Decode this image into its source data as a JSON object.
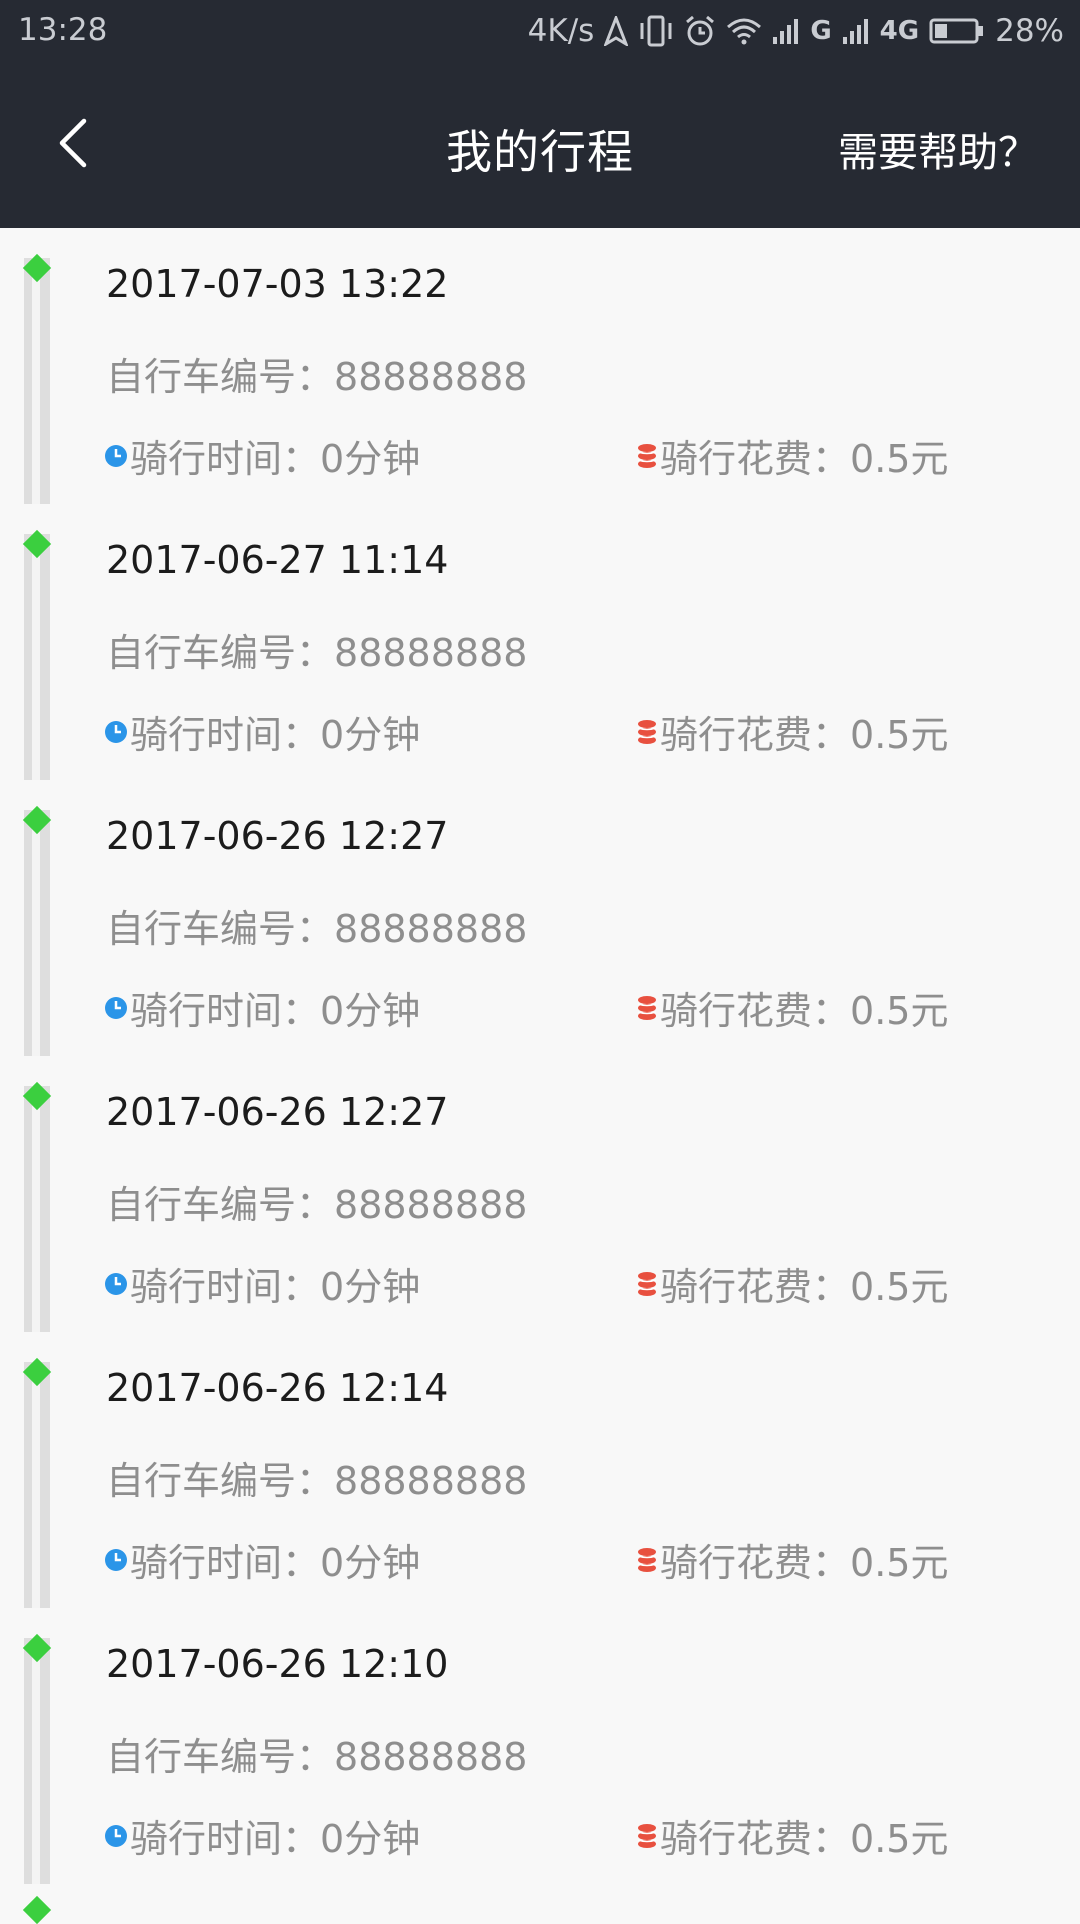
{
  "status_bar": {
    "time": "13:28",
    "network_speed": "4K/s",
    "network_g": "G",
    "network_4g": "4G",
    "battery": "28%",
    "icons": [
      "navigation-icon",
      "vibrate-icon",
      "alarm-icon",
      "wifi-icon",
      "signal-icon",
      "battery-icon"
    ]
  },
  "header": {
    "title": "我的行程",
    "help": "需要帮助？",
    "back_icon": "chevron-left-icon"
  },
  "labels": {
    "bike_no": "自行车编号：",
    "duration": "骑行时间：",
    "cost": "骑行花费："
  },
  "trips": [
    {
      "datetime": "2017-07-03 13:22",
      "bike_no": "88888888",
      "duration": "0分钟",
      "cost": "0.5元"
    },
    {
      "datetime": "2017-06-27 11:14",
      "bike_no": "88888888",
      "duration": "0分钟",
      "cost": "0.5元"
    },
    {
      "datetime": "2017-06-26 12:27",
      "bike_no": "88888888",
      "duration": "0分钟",
      "cost": "0.5元"
    },
    {
      "datetime": "2017-06-26 12:27",
      "bike_no": "88888888",
      "duration": "0分钟",
      "cost": "0.5元"
    },
    {
      "datetime": "2017-06-26 12:14",
      "bike_no": "88888888",
      "duration": "0分钟",
      "cost": "0.5元"
    },
    {
      "datetime": "2017-06-26 12:10",
      "bike_no": "88888888",
      "duration": "0分钟",
      "cost": "0.5元"
    }
  ],
  "colors": {
    "header_bg": "#262a33",
    "timeline_dot": "#3bcf3f",
    "clock_icon": "#2b95e8",
    "coin_icon": "#e8503f"
  }
}
